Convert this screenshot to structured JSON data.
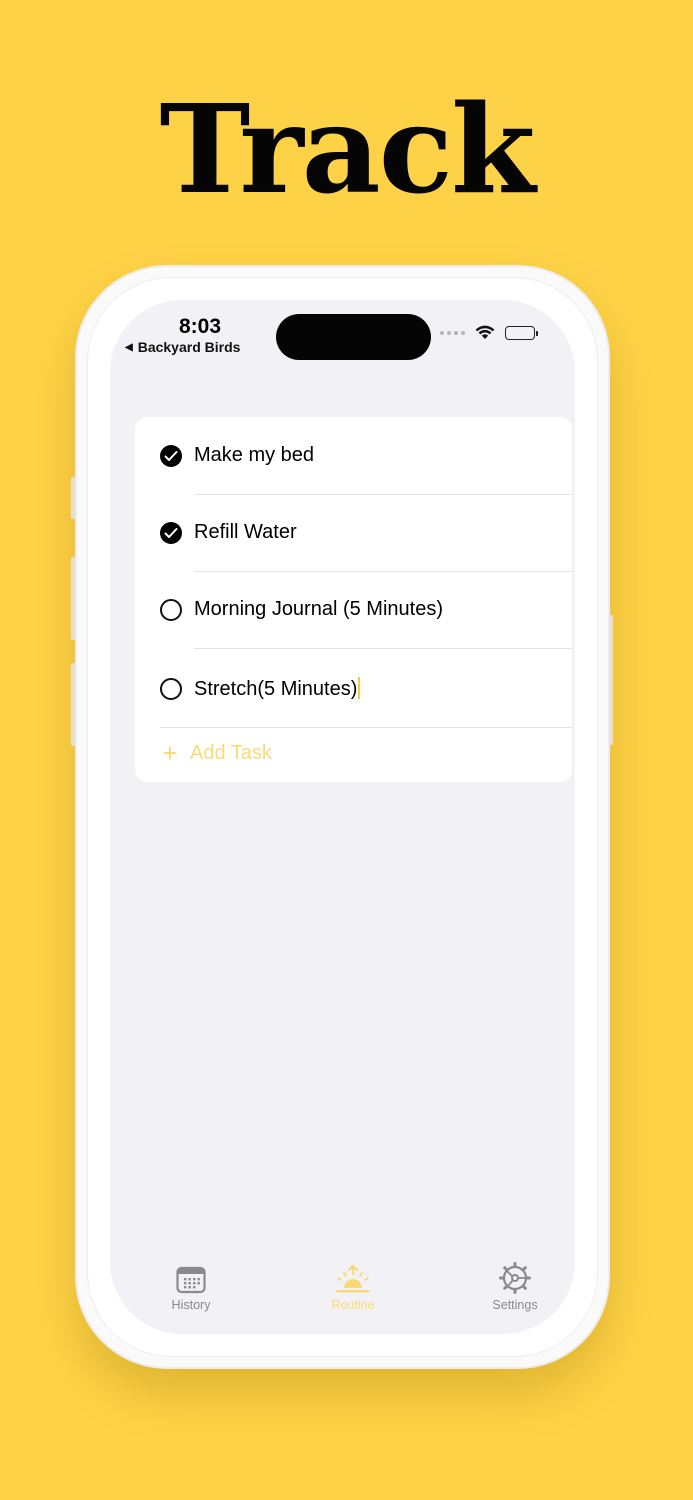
{
  "headline": "Track",
  "status_bar": {
    "time": "8:03",
    "back_app": "Backyard Birds"
  },
  "tasks": [
    {
      "label": "Make my bed",
      "done": true
    },
    {
      "label": "Refill Water",
      "done": true
    },
    {
      "label": "Morning Journal (5 Minutes)",
      "done": false
    },
    {
      "label": "Stretch(5 Minutes)",
      "done": false
    }
  ],
  "add_task_label": "Add Task",
  "tabs": [
    {
      "label": "History",
      "icon": "calendar-icon",
      "active": false
    },
    {
      "label": "Routine",
      "icon": "sunrise-icon",
      "active": true
    },
    {
      "label": "Settings",
      "icon": "gear-icon",
      "active": false
    }
  ],
  "colors": {
    "background": "#FED246",
    "accent": "#FCD977",
    "screen": "#F2F2F6"
  }
}
